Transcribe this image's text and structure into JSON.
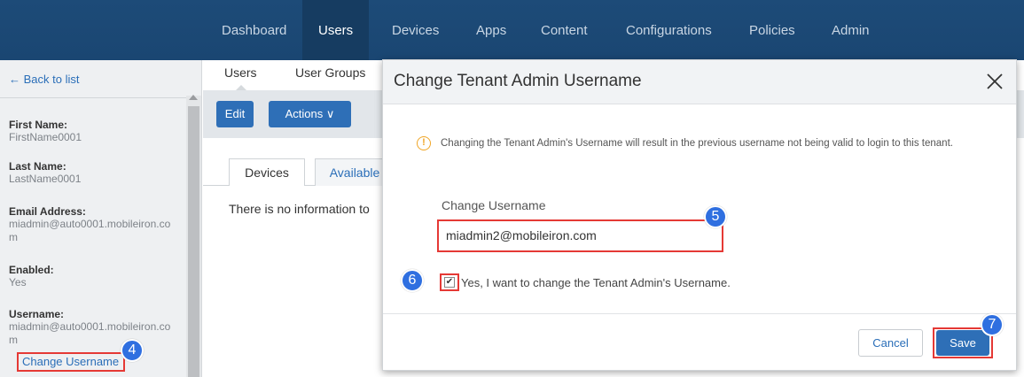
{
  "topnav": {
    "items": [
      "Dashboard",
      "Users",
      "Devices",
      "Apps",
      "Content",
      "Configurations",
      "Policies",
      "Admin"
    ],
    "active": "Users"
  },
  "leftpanel": {
    "back_link": "← Back to list",
    "fields": [
      {
        "label": "First Name:",
        "value": "FirstName0001"
      },
      {
        "label": "Last Name:",
        "value": "LastName0001"
      },
      {
        "label": "Email Address:",
        "value": "miadmin@auto0001.mobileiron.com"
      },
      {
        "label": "Enabled:",
        "value": "Yes"
      },
      {
        "label": "Username:",
        "value": "miadmin@auto0001.mobileiron.com"
      }
    ],
    "change_username_link": "Change Username"
  },
  "subnav": {
    "users": "Users",
    "user_groups": "User Groups"
  },
  "toolbar": {
    "edit": "Edit",
    "actions": "Actions ∨"
  },
  "tabs": {
    "devices": "Devices",
    "available": "Available"
  },
  "main": {
    "empty_message": "There is no information to"
  },
  "modal": {
    "title": "Change Tenant Admin Username",
    "warning": "Changing the Tenant Admin's Username will result in the previous username not being valid to login to this tenant.",
    "field_label": "Change Username",
    "username_value": "miadmin2@mobileiron.com",
    "checkbox_label": "Yes, I want to change the Tenant Admin's Username.",
    "checkbox_checked": true,
    "cancel": "Cancel",
    "save": "Save"
  },
  "badges": {
    "b4": "4",
    "b5": "5",
    "b6": "6",
    "b7": "7"
  },
  "colors": {
    "nav_bg": "#1d4b78",
    "accent": "#2e6fb7",
    "highlight": "#e53935",
    "badge": "#2f6fe0"
  }
}
